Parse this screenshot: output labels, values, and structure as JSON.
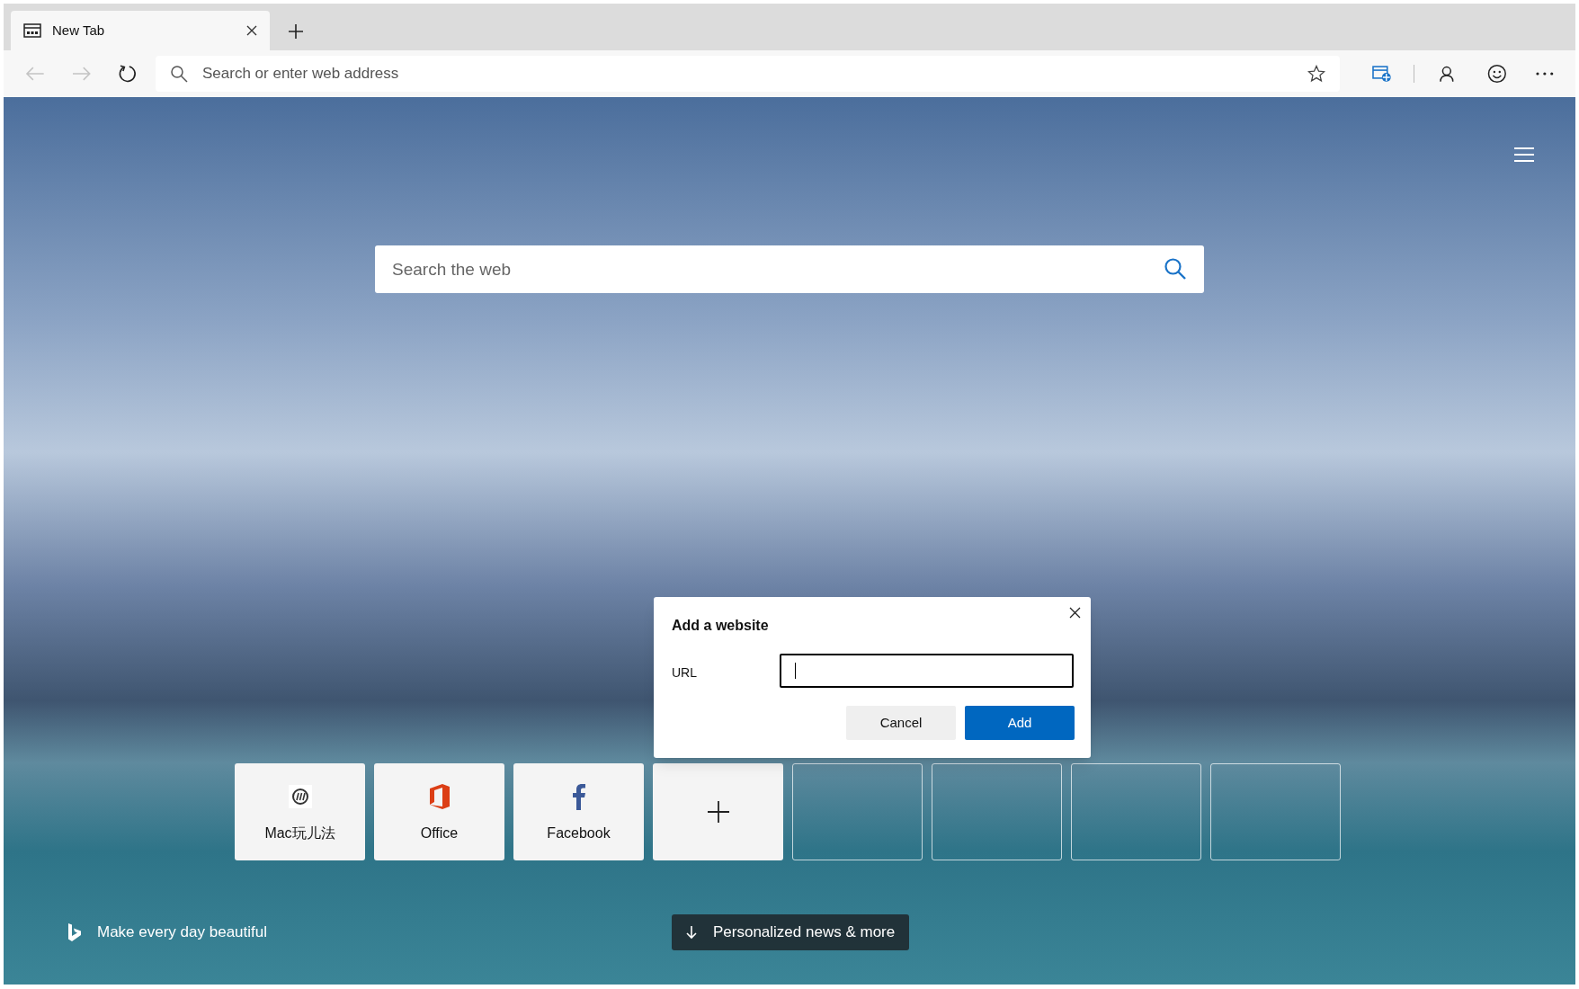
{
  "tab": {
    "title": "New Tab"
  },
  "address_bar": {
    "placeholder": "Search or enter web address"
  },
  "search": {
    "placeholder": "Search the web"
  },
  "dialog": {
    "title": "Add a website",
    "url_label": "URL",
    "buttons": [
      {
        "label": "Cancel",
        "kind": "secondary"
      },
      {
        "label": "Add",
        "kind": "primary"
      }
    ]
  },
  "tiles": [
    {
      "label": "Mac玩儿法",
      "kind": "mac"
    },
    {
      "label": "Office",
      "kind": "office"
    },
    {
      "label": "Facebook",
      "kind": "facebook"
    },
    {
      "kind": "add"
    },
    {
      "kind": "empty"
    },
    {
      "kind": "empty"
    },
    {
      "kind": "empty"
    },
    {
      "kind": "empty"
    }
  ],
  "footer": {
    "tagline": "Make every day beautiful",
    "news_button": "Personalized news & more"
  }
}
